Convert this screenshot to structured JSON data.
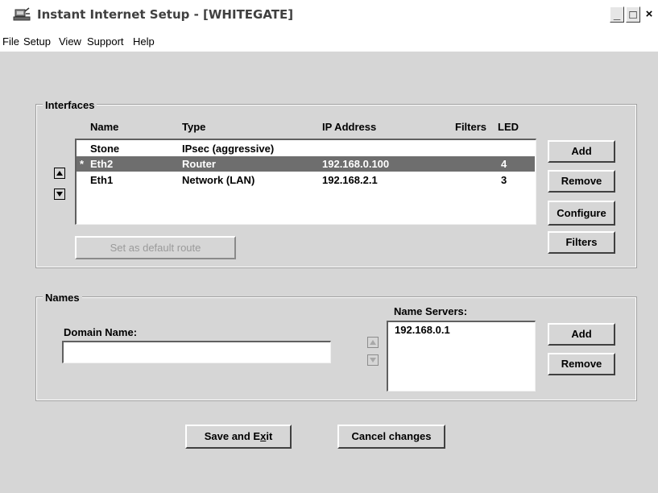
{
  "window": {
    "title": "Instant Internet Setup - [WHITEGATE]",
    "controls": {
      "minimize": "_",
      "maximize": "□",
      "close": "×"
    }
  },
  "menu": [
    "File",
    "Setup",
    "View",
    "Support",
    "Help"
  ],
  "interfaces": {
    "group_title": "Interfaces",
    "columns": [
      "Name",
      "Type",
      "IP Address",
      "Filters",
      "LED"
    ],
    "rows": [
      {
        "marker": "",
        "name": "Stone",
        "type": "IPsec (aggressive)",
        "ip": "",
        "filters": "",
        "led": "",
        "selected": false
      },
      {
        "marker": "*",
        "name": "Eth2",
        "type": "Router",
        "ip": "192.168.0.100",
        "filters": "",
        "led": "4",
        "selected": true
      },
      {
        "marker": "",
        "name": "Eth1",
        "type": "Network (LAN)",
        "ip": "192.168.2.1",
        "filters": "",
        "led": "3",
        "selected": false
      }
    ],
    "buttons": {
      "add": "Add",
      "remove": "Remove",
      "configure": "Configure",
      "filters": "Filters",
      "default_route": "Set as default route"
    }
  },
  "names": {
    "group_title": "Names",
    "domain_label": "Domain Name:",
    "domain_value": "",
    "name_servers_label": "Name Servers:",
    "name_servers": [
      "192.168.0.1"
    ],
    "buttons": {
      "add": "Add",
      "remove": "Remove"
    }
  },
  "footer": {
    "save_prefix": "Save and E",
    "save_accel": "x",
    "save_suffix": "it",
    "cancel": "Cancel changes"
  },
  "colors": {
    "selection": "#6e6e6e",
    "dialog_bg": "#d6d6d6"
  },
  "icons": {
    "app": "setup-app-icon"
  }
}
